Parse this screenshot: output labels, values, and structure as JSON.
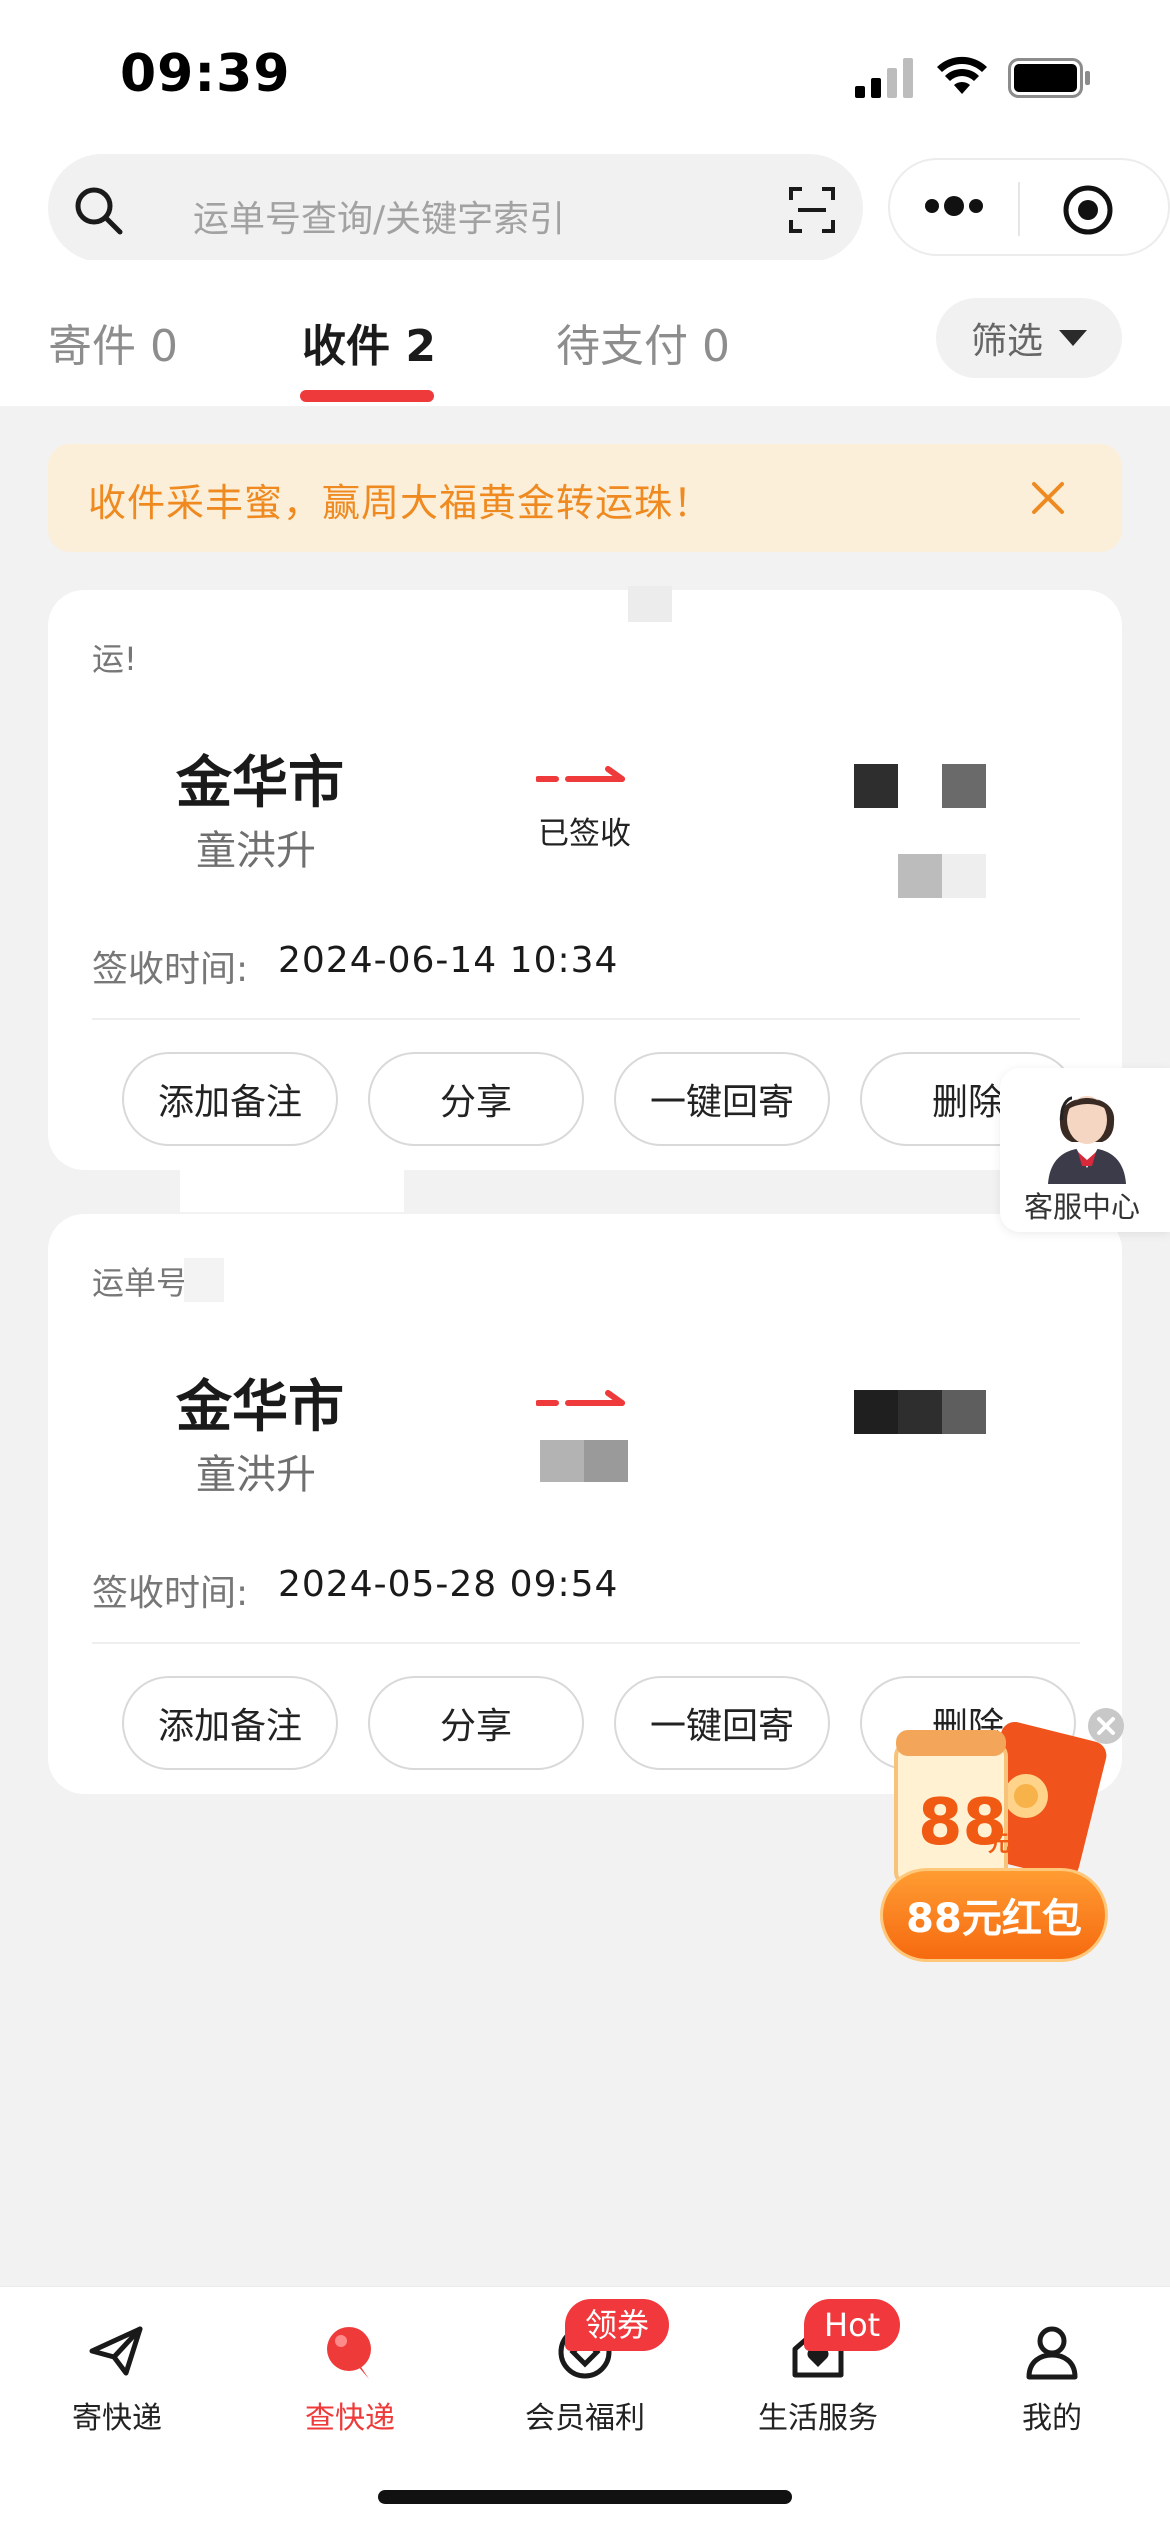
{
  "status_bar": {
    "time": "09:39"
  },
  "search": {
    "placeholder": "运单号查询/关键字索引"
  },
  "tabs": [
    {
      "label": "寄件 0",
      "active": false
    },
    {
      "label": "收件 2",
      "active": true
    },
    {
      "label": "待支付 0",
      "active": false
    }
  ],
  "filter_label": "筛选",
  "banner": {
    "text": "收件采丰蜜，赢周大福黄金转运珠！"
  },
  "shipments": [
    {
      "waybill_label": "运!",
      "city": "金华市",
      "person": "童洪升",
      "status": "已签收",
      "sign_label": "签收时间:",
      "sign_time": "2024-06-14 10:34",
      "actions": [
        "添加备注",
        "分享",
        "一键回寄",
        "删除"
      ]
    },
    {
      "waybill_label": "运单号",
      "city": "金华市",
      "person": "童洪升",
      "status": "",
      "sign_label": "签收时间:",
      "sign_time": "2024-05-28 09:54",
      "actions": [
        "添加备注",
        "分享",
        "一键回寄",
        "删除"
      ]
    }
  ],
  "customer_service": {
    "label": "客服中心"
  },
  "promo": {
    "amount": "88",
    "unit": "元",
    "pill": "88元红包"
  },
  "tabbar": [
    {
      "label": "寄快递",
      "icon": "send-plane-icon",
      "active": false,
      "badge": ""
    },
    {
      "label": "查快递",
      "icon": "track-balloon-icon",
      "active": true,
      "badge": ""
    },
    {
      "label": "会员福利",
      "icon": "member-coin-icon",
      "active": false,
      "badge": "领券"
    },
    {
      "label": "生活服务",
      "icon": "life-home-icon",
      "active": false,
      "badge": "Hot"
    },
    {
      "label": "我的",
      "icon": "user-icon",
      "active": false,
      "badge": ""
    }
  ],
  "colors": {
    "accent": "#ee3a3a",
    "banner_bg": "#fbefd9",
    "banner_text": "#ef8a21"
  }
}
